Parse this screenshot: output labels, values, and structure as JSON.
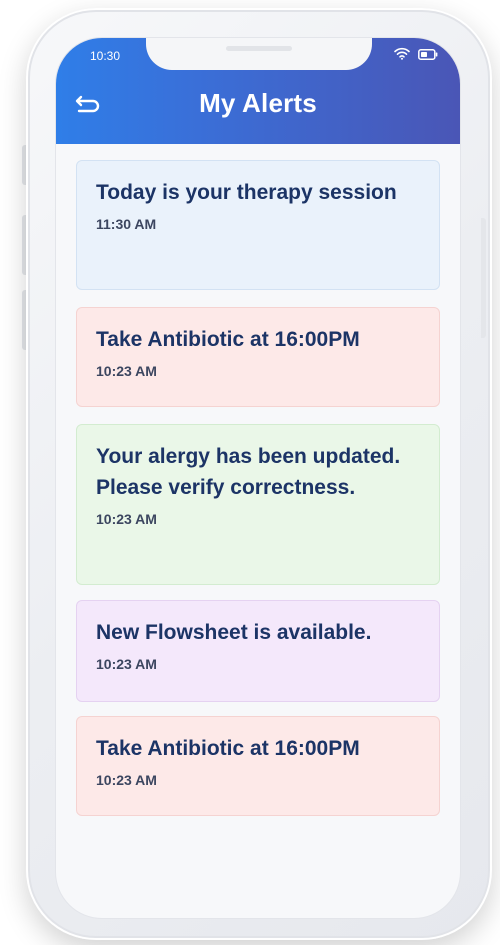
{
  "status_bar": {
    "time": "10:30",
    "icons": [
      "wifi-icon",
      "battery-icon"
    ]
  },
  "header": {
    "title": "My Alerts",
    "back_icon": "back-arrow-icon",
    "gradient": [
      "#2f7ee8",
      "#4a56b6"
    ]
  },
  "alerts": [
    {
      "message": "Today is your therapy session",
      "time": "11:30 AM",
      "color": "#eaf2fb",
      "border": "#d3e2f3"
    },
    {
      "message": "Take Antibiotic at 16:00PM",
      "time": "10:23 AM",
      "color": "#fde9e8",
      "border": "#f5d3d1"
    },
    {
      "message": "Your alergy has been updated. Please verify correctness.",
      "time": "10:23 AM",
      "color": "#eaf7e8",
      "border": "#d3ecd0"
    },
    {
      "message": "New Flowsheet is available.",
      "time": "10:23 AM",
      "color": "#f4e8fb",
      "border": "#e5d2f1"
    },
    {
      "message": "Take Antibiotic at 16:00PM",
      "time": "10:23 AM",
      "color": "#fde9e8",
      "border": "#f5d3d1"
    }
  ]
}
